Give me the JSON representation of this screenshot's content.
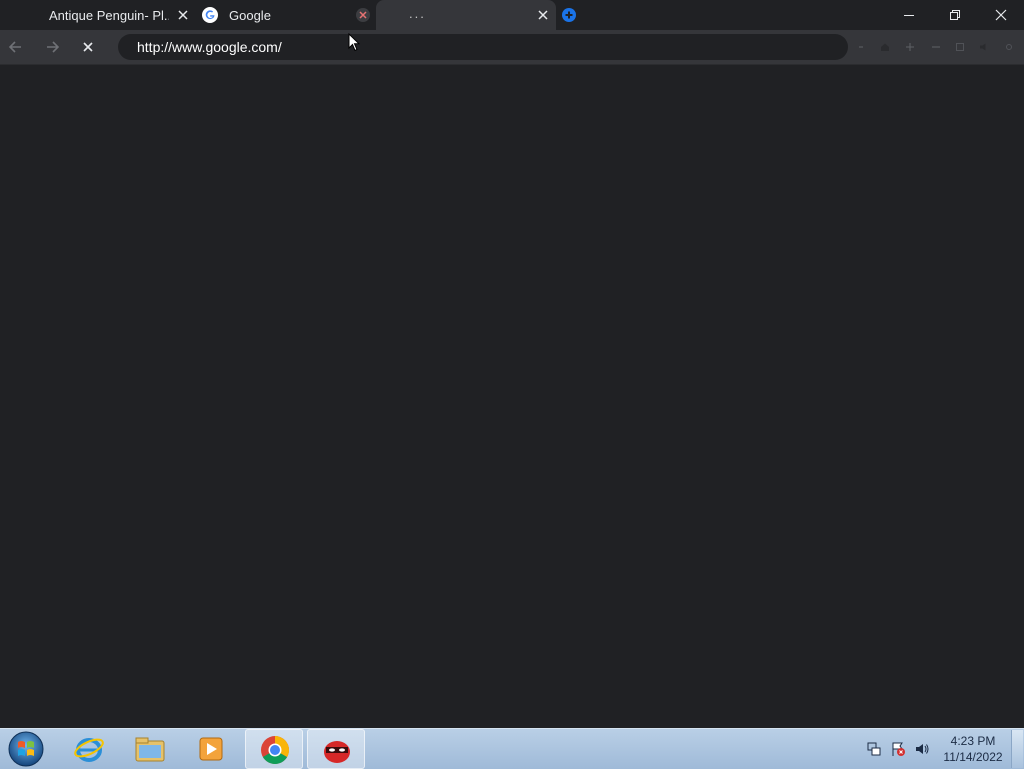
{
  "browser": {
    "tabs": [
      {
        "title": "Antique Penguin- Pl...",
        "favicon": "none"
      },
      {
        "title": "Google",
        "favicon": "google-g-icon"
      },
      {
        "title": "...",
        "favicon": "none",
        "active": true
      }
    ],
    "new_tab_icon": "plus-circle-icon",
    "address_bar": {
      "url": "http://www.google.com/"
    },
    "colors": {
      "frame": "#202124",
      "toolbar": "#35363a",
      "omnibox": "#202124",
      "new_tab_accent": "#1a73e8"
    }
  },
  "taskbar": {
    "pinned": [
      "start-orb-icon",
      "internet-explorer-icon",
      "file-explorer-icon",
      "media-player-icon",
      "chrome-icon",
      "ninja-app-icon"
    ],
    "tray": [
      "network-icon",
      "action-center-flag-icon",
      "volume-icon"
    ],
    "clock": {
      "time": "4:23 PM",
      "date": "11/14/2022"
    }
  }
}
